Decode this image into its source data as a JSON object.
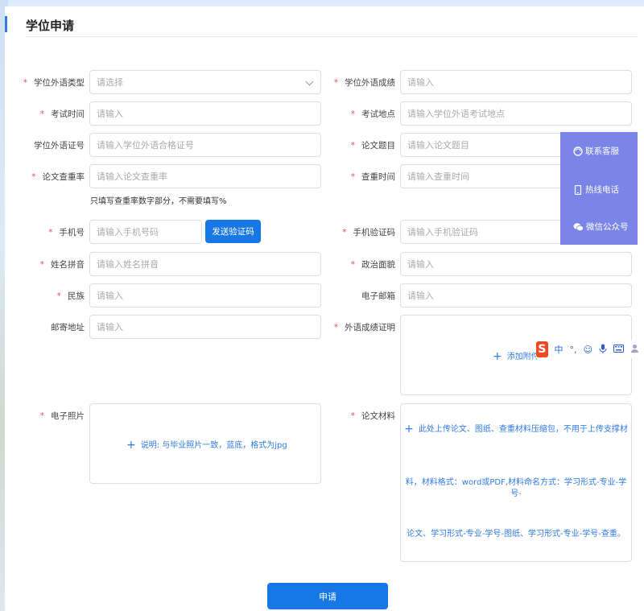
{
  "page": {
    "title": "学位申请"
  },
  "form": {
    "required_mark": "*",
    "fields": {
      "degree_language_type": {
        "label": "学位外语类型",
        "placeholder": "请选择"
      },
      "degree_language_score": {
        "label": "学位外语成绩",
        "placeholder": "请输入"
      },
      "exam_time": {
        "label": "考试时间",
        "placeholder": "请输入"
      },
      "exam_location": {
        "label": "考试地点",
        "placeholder": "请输入学位外语考试地点"
      },
      "language_cert_no": {
        "label": "学位外语证号",
        "placeholder": "请输入学位外语合格证号"
      },
      "thesis_title": {
        "label": "论文题目",
        "placeholder": "请输入论文题目"
      },
      "plagiarism_rate": {
        "label": "论文查重率",
        "placeholder": "请输入论文查重率",
        "hint": "只填写查重率数字部分，不需要填写%"
      },
      "check_time": {
        "label": "查重时间",
        "placeholder": "请输入查重时间"
      },
      "phone": {
        "label": "手机号",
        "placeholder": "请输入手机号码",
        "send_code_label": "发送验证码"
      },
      "phone_code": {
        "label": "手机验证码",
        "placeholder": "请输入手机验证码"
      },
      "name_pinyin": {
        "label": "姓名拼音",
        "placeholder": "请输入姓名拼音"
      },
      "political_status": {
        "label": "政治面貌",
        "placeholder": "请输入"
      },
      "ethnicity": {
        "label": "民族",
        "placeholder": "请输入"
      },
      "email": {
        "label": "电子邮箱",
        "placeholder": "请输入"
      },
      "mail_address": {
        "label": "邮寄地址",
        "placeholder": "请输入"
      },
      "score_proof": {
        "label": "外语成绩证明",
        "upload_label": "添加附件"
      },
      "photo": {
        "label": "电子照片",
        "upload_label": "说明: 与毕业照片一致，蓝底，格式为jpg"
      },
      "thesis_material": {
        "label": "论文材料",
        "upload_lines": [
          "此处上传论文、图纸、查重材料压缩包，不用于上传支撑材",
          "料，材料格式：word或PDF,材料命名方式：学习形式-专业-学号-",
          "论文、学习形式-专业-学号-图纸、学习形式-专业-学号-查重。"
        ]
      }
    },
    "submit_label": "申请"
  },
  "float_panel": {
    "items": [
      {
        "label": "联系客服",
        "icon": "customer-service-icon"
      },
      {
        "label": "热线电话",
        "icon": "phone-icon"
      },
      {
        "label": "微信公众号",
        "icon": "wechat-icon"
      }
    ],
    "color": "#7b85e8"
  },
  "ime_toolbar": {
    "logo": "S",
    "items": [
      "中",
      "°,"
    ]
  },
  "colors": {
    "primary": "#1677e5",
    "required": "#f05050",
    "link": "#2f7be5"
  }
}
